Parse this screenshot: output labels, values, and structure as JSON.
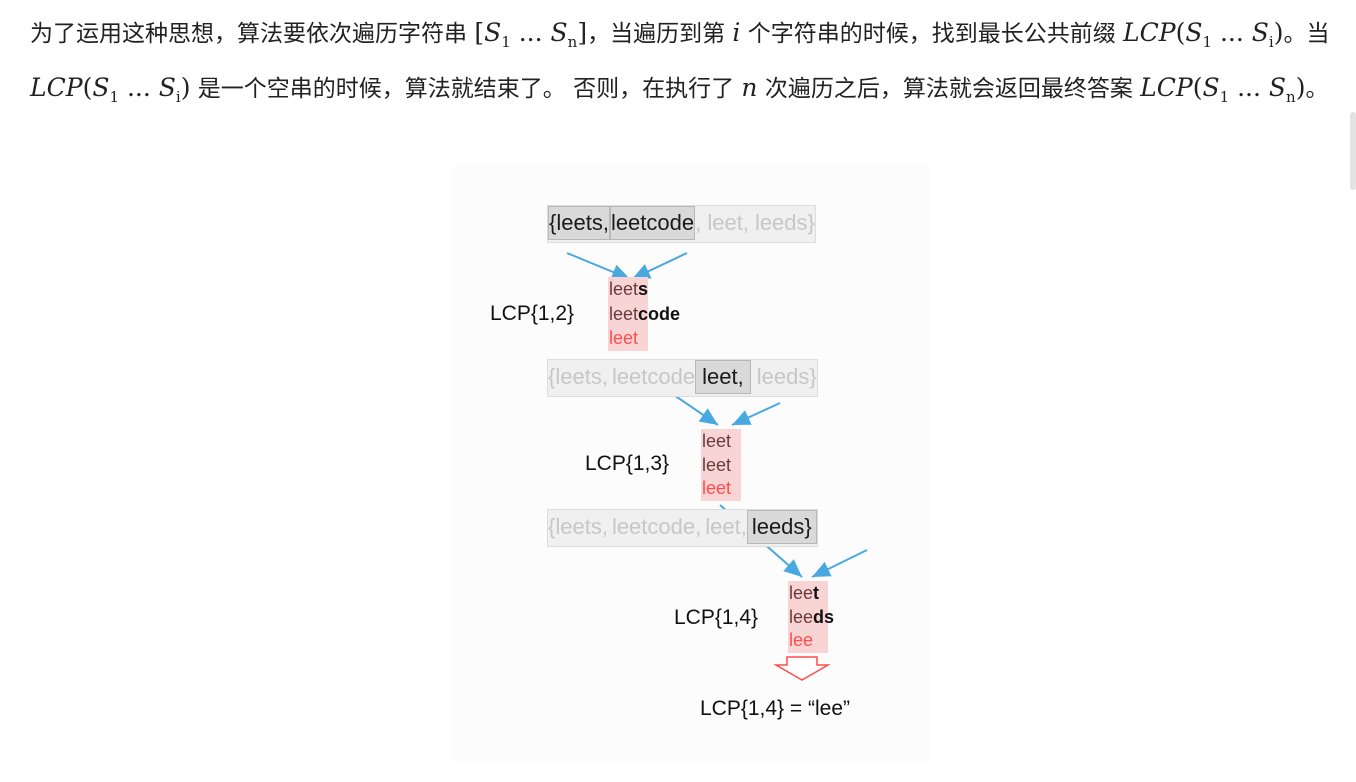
{
  "paragraph": {
    "t1": "为了运用这种思想，算法要依次遍历字符串 ",
    "t2": "，当遍历到第 ",
    "t3": " 个字符串的时候，找到最长公共前缀 ",
    "t4": "。当 ",
    "t5": " 是一个空串的时候，算法就结束了。 否则，在执行了 ",
    "t6": " 次遍历之后，算法就会返回最终答案 ",
    "t7": "。",
    "i_var": "i",
    "n_var": "n",
    "lcp": "LCP",
    "s1": "S",
    "sub1": "1",
    "subi": "i",
    "subn": "n",
    "dots": "…"
  },
  "diagram": {
    "rows": [
      {
        "items": [
          "{leets,",
          "leetcode",
          ", leet,",
          "leeds}"
        ],
        "highlight": [
          0,
          1
        ]
      },
      {
        "items": [
          "{leets,",
          "leetcode",
          "leet,",
          "leeds}"
        ],
        "highlight": [
          2
        ]
      },
      {
        "items": [
          "{leets,",
          "leetcode,",
          "leet,",
          "leeds}"
        ],
        "highlight": [
          3
        ]
      }
    ],
    "steps": [
      {
        "label": "LCP{1,2}",
        "w1_prefix": "leet",
        "w1_suffix": "s",
        "w2_prefix": "leet",
        "w2_suffix": "code",
        "result": "leet"
      },
      {
        "label": "LCP{1,3}",
        "w1_prefix": "leet",
        "w1_suffix": "",
        "w2_prefix": "leet",
        "w2_suffix": "",
        "result": "leet"
      },
      {
        "label": "LCP{1,4}",
        "w1_prefix": "lee",
        "w1_suffix": "t",
        "w2_prefix": "lee",
        "w2_suffix": "ds",
        "result": "lee"
      }
    ],
    "final": "LCP{1,4} = “lee”",
    "colors": {
      "arrow": "#4aa8e0",
      "highlight_bg": "#f8d4d4",
      "result_text": "#ff4d4d",
      "dim_text": "#c7c7c7"
    }
  }
}
